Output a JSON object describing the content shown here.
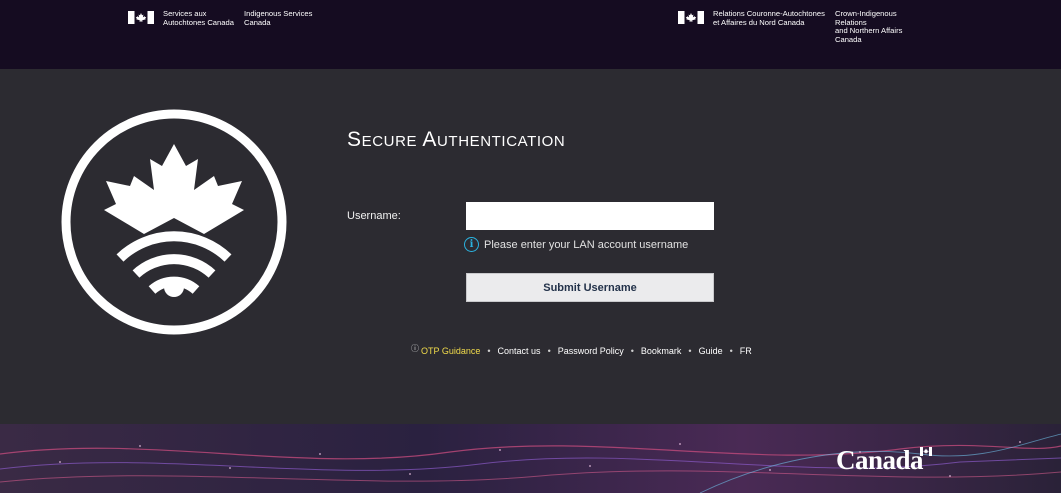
{
  "header": {
    "left_fip": {
      "fr": "Services aux\nAutochtones Canada",
      "en": "Indigenous Services\nCanada"
    },
    "right_fip": {
      "fr": "Relations Couronne-Autochtones\net Affaires du Nord Canada",
      "en": "Crown-Indigenous Relations\nand Northern Affairs Canada"
    }
  },
  "form": {
    "title": "Secure Authentication",
    "username_label": "Username:",
    "username_value": "",
    "hint": "Please enter your LAN account username",
    "submit_label": "Submit Username"
  },
  "footer_links": {
    "otp": "OTP Guidance",
    "contact": "Contact us",
    "password": "Password Policy",
    "bookmark": "Bookmark",
    "guide": "Guide",
    "lang": "FR"
  },
  "wordmark": "Canada",
  "colors": {
    "banner_bg": "#150c21",
    "panel_bg": "#2c2b31",
    "link_highlight": "#f2dc4b",
    "info_blue": "#2bb3e0",
    "button_text": "#23324a"
  }
}
